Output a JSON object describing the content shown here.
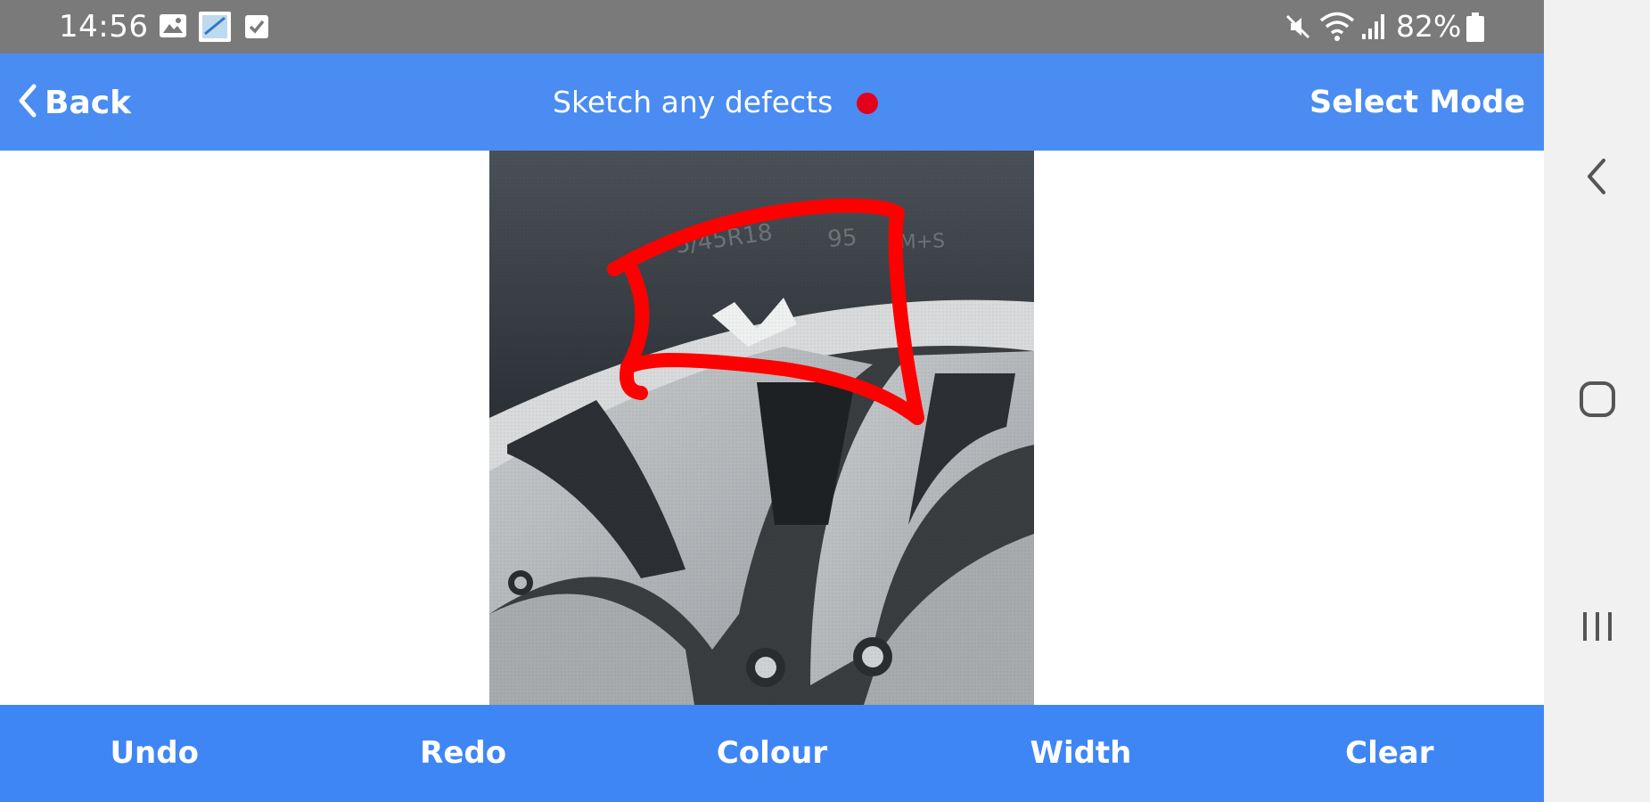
{
  "status_bar": {
    "time": "14:56",
    "battery": "82%",
    "icons": [
      "gallery-icon",
      "image-edit-icon",
      "checkbox-icon",
      "mute-icon",
      "wifi-icon",
      "signal-icon",
      "battery-icon"
    ]
  },
  "header": {
    "back_label": "Back",
    "title": "Sketch any defects",
    "action_label": "Select Mode",
    "recording_dot_color": "#e3001b"
  },
  "canvas": {
    "content": "tyre-wheel-photo",
    "sketch_color": "#ff0000"
  },
  "toolbar": {
    "buttons": [
      "Undo",
      "Redo",
      "Colour",
      "Width",
      "Clear"
    ]
  },
  "nav_bar": {
    "buttons": [
      "back-icon",
      "home-icon",
      "recents-icon"
    ]
  },
  "colors": {
    "header_bg": "#4a8cf2",
    "toolbar_bg": "#3f86f5",
    "status_bg": "#7a7a7a",
    "nav_bg": "#f1f1f1"
  }
}
